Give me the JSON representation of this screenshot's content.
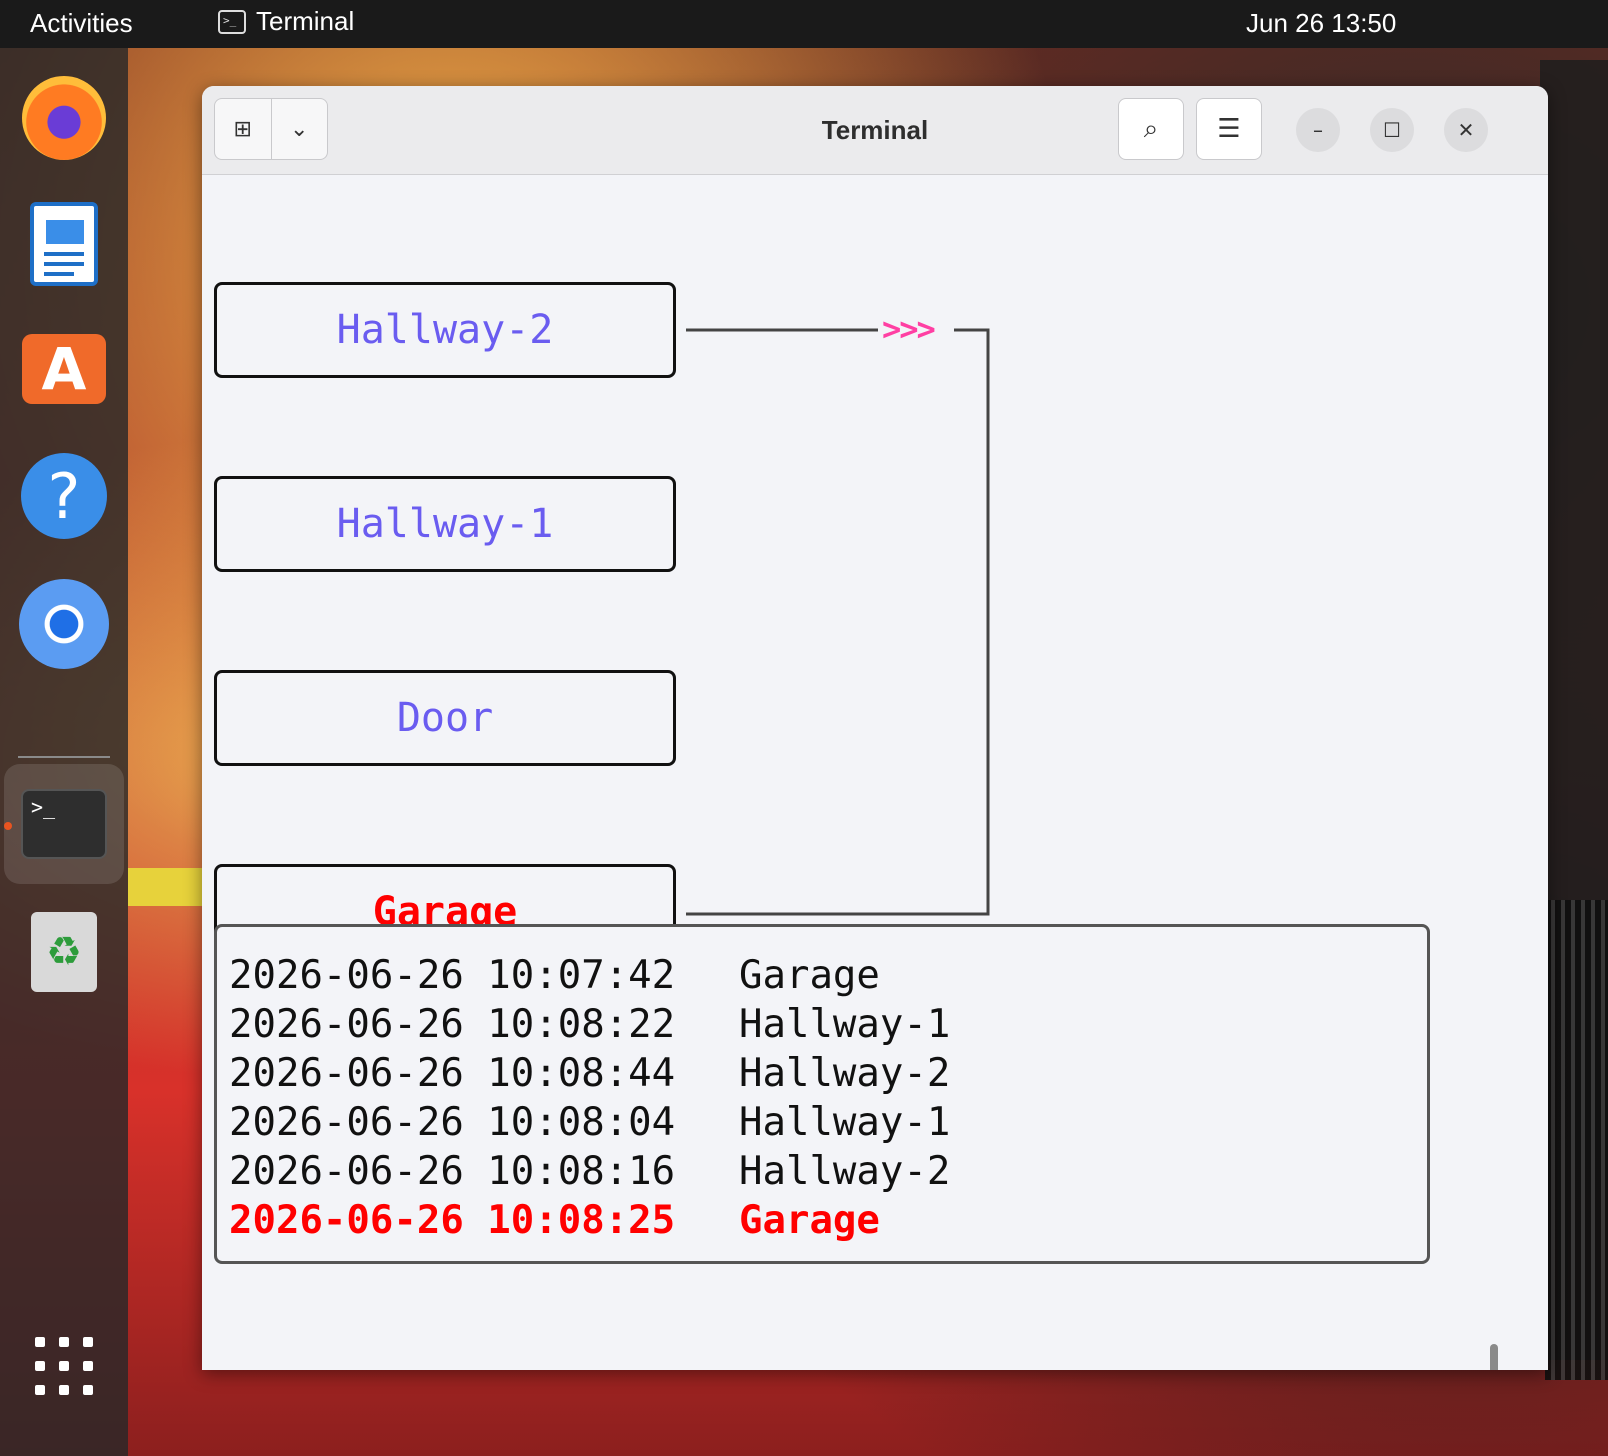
{
  "topbar": {
    "activities": "Activities",
    "app_name": "Terminal",
    "app_icon_glyph": ">_",
    "clock": "Jun 26  13:50"
  },
  "dock": {
    "items": [
      {
        "name": "firefox",
        "icon": "firefox-icon"
      },
      {
        "name": "writer",
        "icon": "document-icon"
      },
      {
        "name": "software",
        "icon": "app-store-icon",
        "glyph": "A"
      },
      {
        "name": "help",
        "icon": "help-icon",
        "glyph": "?"
      },
      {
        "name": "chromium",
        "icon": "chrome-icon"
      },
      {
        "name": "terminal",
        "icon": "terminal-icon",
        "glyph": ">_"
      },
      {
        "name": "trash",
        "icon": "trash-icon",
        "glyph": "♻"
      }
    ]
  },
  "window": {
    "title": "Terminal",
    "new_tab_glyph": "⊞",
    "dropdown_glyph": "⌄",
    "search_glyph": "⌕",
    "menu_glyph": "☰",
    "minimize_glyph": "–",
    "maximize_glyph": "☐",
    "close_glyph": "✕"
  },
  "diagram": {
    "nodes": [
      {
        "label": "Hallway-2",
        "active": false
      },
      {
        "label": "Hallway-1",
        "active": false
      },
      {
        "label": "Door",
        "active": false
      },
      {
        "label": "Garage",
        "active": true
      }
    ],
    "arrow": ">>>",
    "colors": {
      "node_text": "#6a5cf0",
      "active_text": "#ff0000",
      "arrow": "#ff3fa3"
    }
  },
  "log": {
    "rows": [
      {
        "timestamp": "2026-06-26 10:07:42",
        "location": "Garage",
        "highlight": false
      },
      {
        "timestamp": "2026-06-26 10:08:22",
        "location": "Hallway-1",
        "highlight": false
      },
      {
        "timestamp": "2026-06-26 10:08:44",
        "location": "Hallway-2",
        "highlight": false
      },
      {
        "timestamp": "2026-06-26 10:08:04",
        "location": "Hallway-1",
        "highlight": false
      },
      {
        "timestamp": "2026-06-26 10:08:16",
        "location": "Hallway-2",
        "highlight": false
      },
      {
        "timestamp": "2026-06-26 10:08:25",
        "location": "Garage",
        "highlight": true
      }
    ]
  }
}
